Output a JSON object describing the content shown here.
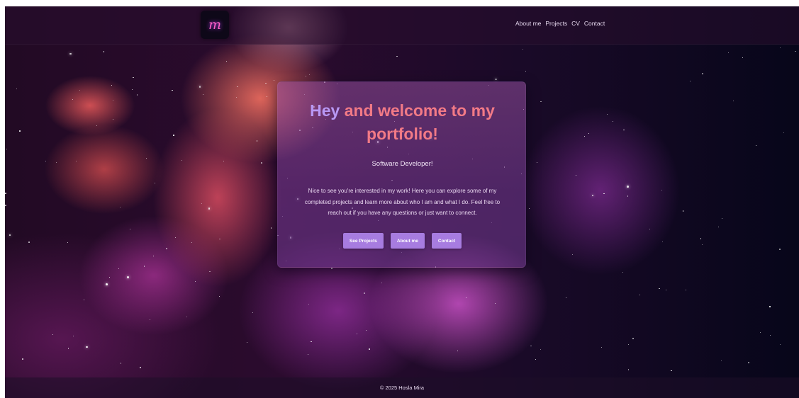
{
  "header": {
    "logo_glyph": "m",
    "nav": [
      "About me",
      "Projects",
      "CV",
      "Contact"
    ]
  },
  "hero": {
    "title_highlight": "Hey",
    "title_rest": " and welcome to my portfolio!",
    "subtitle": "Software Developer!",
    "intro": "Nice to see you're interested in my work! Here you can explore some of my completed projects and learn more about who I am and what I do. Feel free to reach out if you have any questions or just want to connect.",
    "buttons": [
      "See Projects",
      "About me",
      "Contact"
    ]
  },
  "footer": {
    "text": "© 2025 Hosla Mira"
  },
  "colors": {
    "title": "#f27a86",
    "title_highlight": "#b898f4",
    "button": "#a77ce0"
  }
}
